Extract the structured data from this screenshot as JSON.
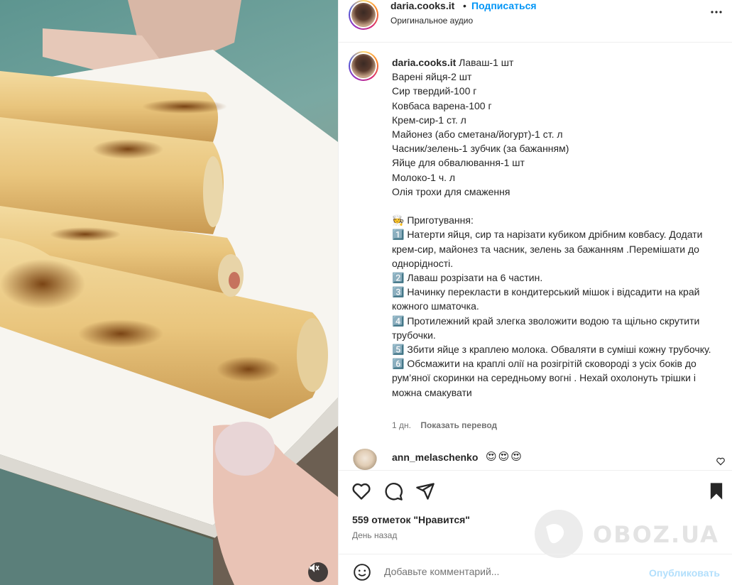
{
  "media": {
    "description_icons": {
      "mute": "mute-icon"
    }
  },
  "header": {
    "username": "daria.cooks.it",
    "dot": "•",
    "follow_label": "Подписаться",
    "audio": "Оригинальное аудио",
    "more_icon": "more-horizontal-icon"
  },
  "caption": {
    "username": "daria.cooks.it",
    "text": " Лаваш-1 шт\nВарені яйця-2 шт\nСир твердий-100 г\nКовбаса варена-100 г\nКрем-сир-1 ст. л\nМайонез (або сметана/йогурт)-1 ст. л\nЧасник/зелень-1 зубчик (за бажанням)\nЯйце для обвалювання-1 шт\nМолоко-1 ч. л\nОлія трохи для смаження\n\n🧑‍🍳 Приготування:\n1️⃣ Натерти яйця, сир та нарізати кубиком дрібним ковбасу. Додати крем-сир, майонез та часник, зелень за бажанням .Перемішати до однорідності.\n2️⃣ Лаваш розрізати на 6 частин.\n3️⃣ Начинку перекласти в кондитерський мішок і відсадити на край кожного шматочка.\n4️⃣ Протилежний край злегка зволожити водою та щільно скрутити трубочки.\n5️⃣ Збити яйце з краплею молока. Обваляти в суміші кожну трубочку.\n6️⃣ Обсмажити на краплі олії на розігрітій сковороді з усіх боків до рум’яної скоринки на середньому вогні . Нехай охолонуть трішки і можна смакувати",
    "age": "1 дн.",
    "translate_label": "Показать перевод"
  },
  "comment": {
    "username": "ann_melaschenko",
    "text": "😍😍😍"
  },
  "actions": {
    "like_icon": "heart-icon",
    "comment_icon": "comment-icon",
    "share_icon": "share-icon",
    "save_icon": "bookmark-icon",
    "likes": "559 отметок \"Нравится\"",
    "date": "День назад"
  },
  "comment_box": {
    "placeholder": "Добавьте комментарий...",
    "post_label": "Опубликовать",
    "emoji_icon": "emoji-icon"
  },
  "watermark": {
    "text": "OBOZ.UA"
  },
  "colors": {
    "accent": "#0095f6",
    "post_disabled": "#b2dffc",
    "muted": "#737373"
  }
}
